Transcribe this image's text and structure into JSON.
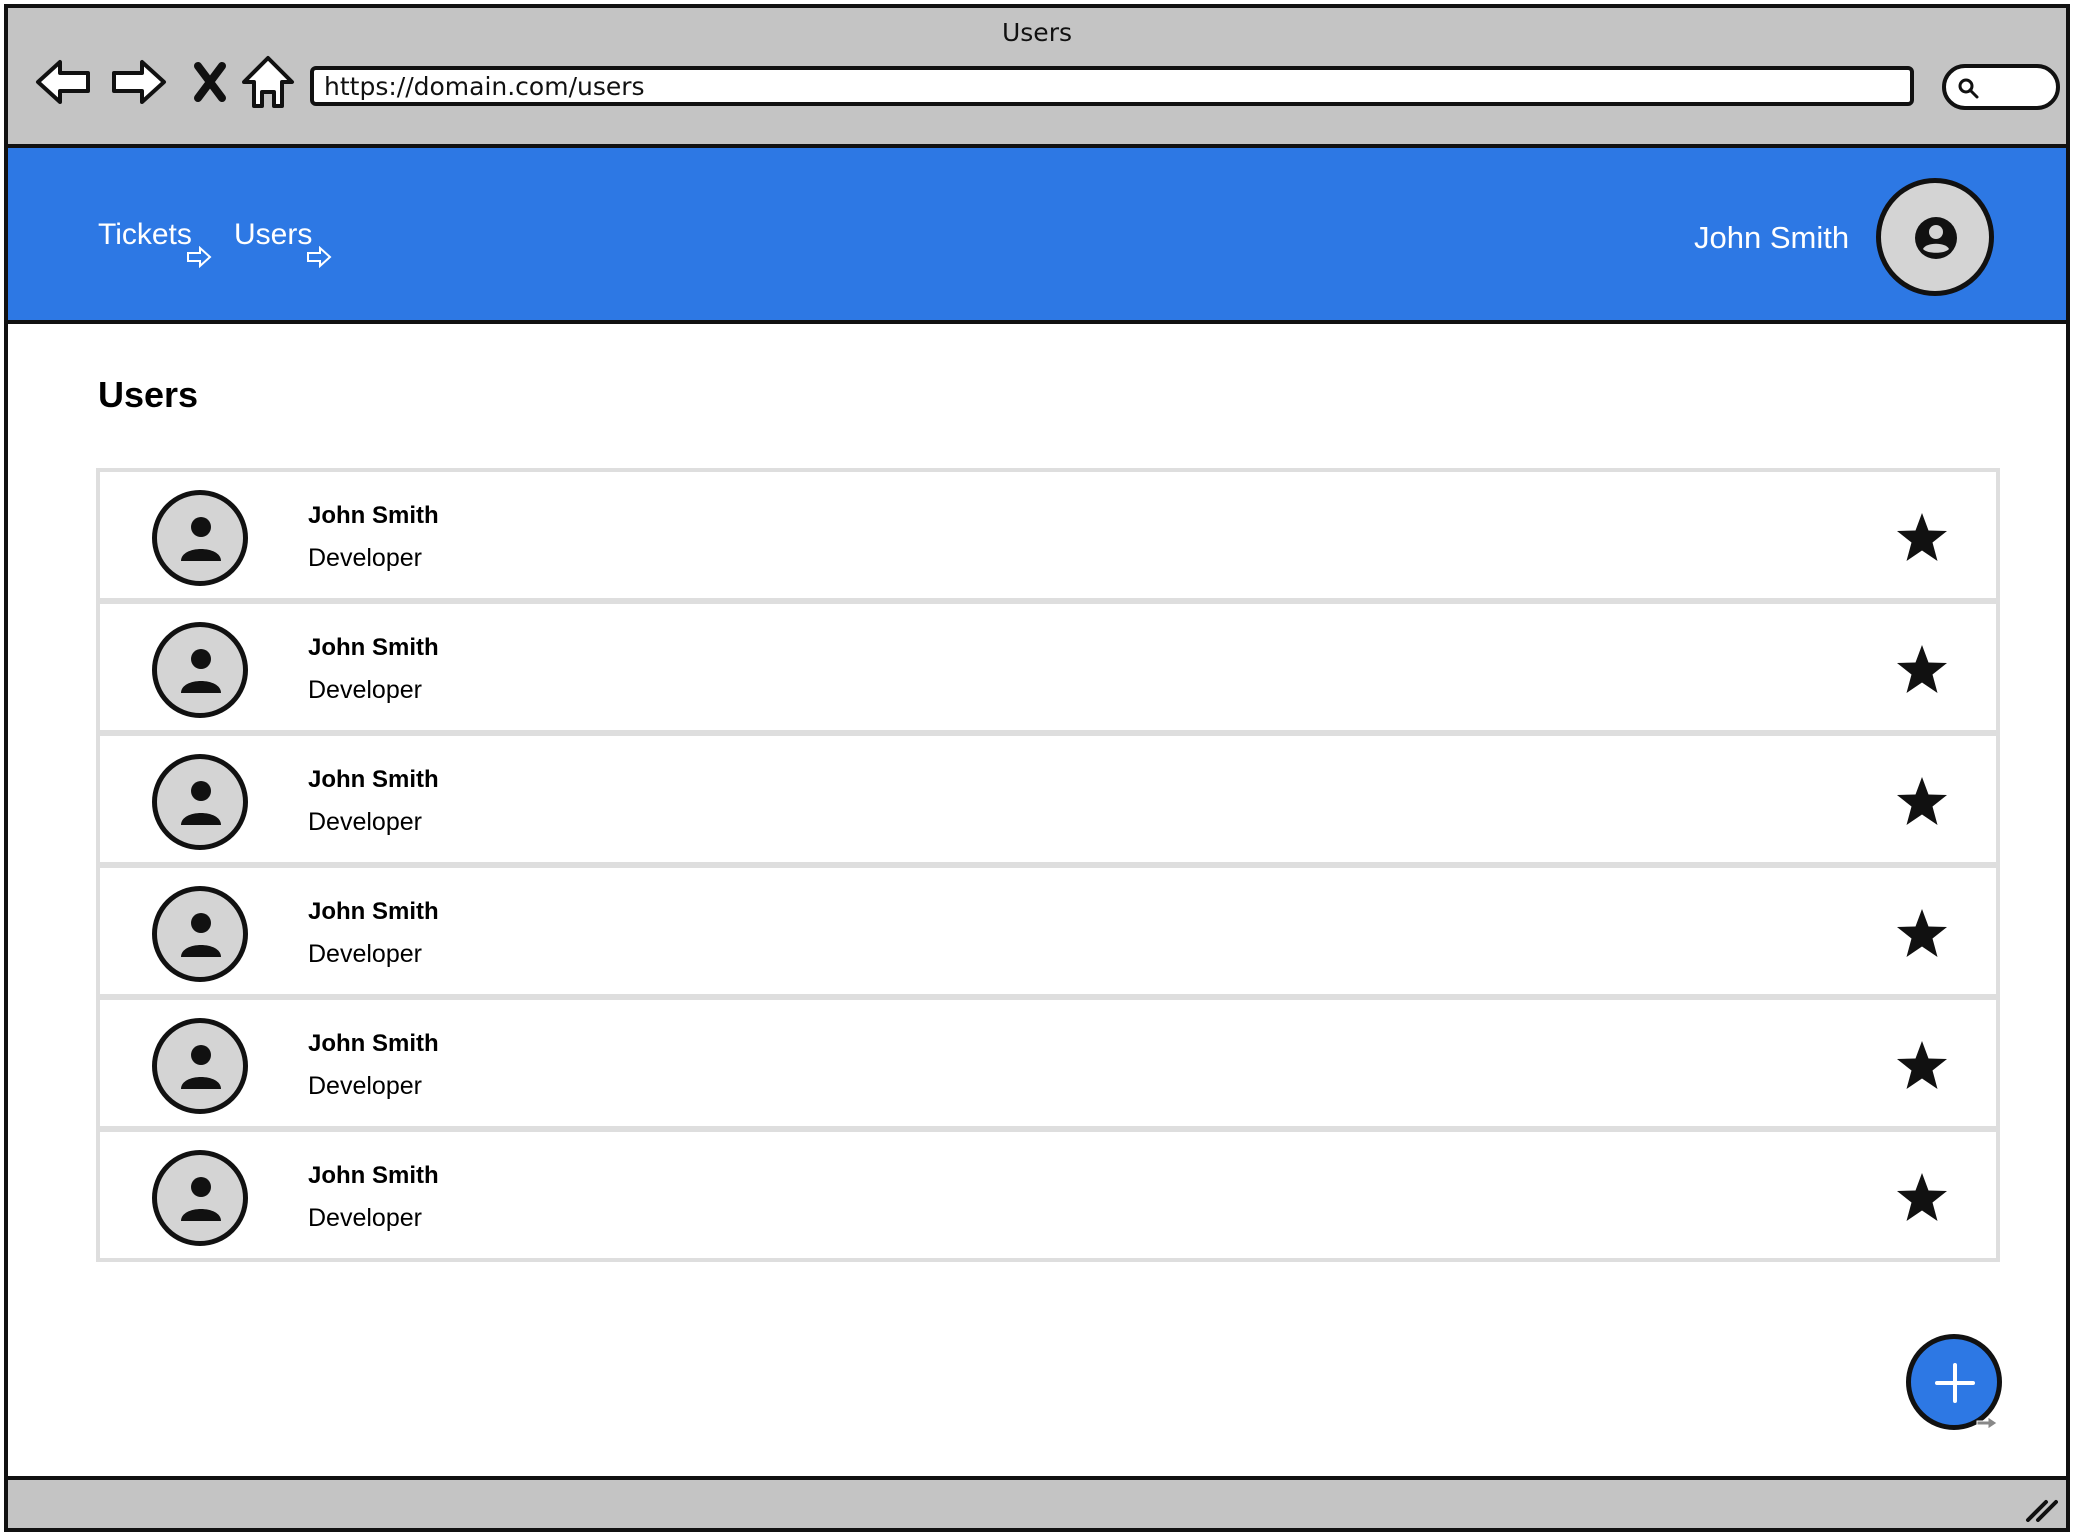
{
  "window": {
    "title": "Users"
  },
  "browser": {
    "url": "https://domain.com/users",
    "back_icon": "back-arrow-icon",
    "forward_icon": "forward-arrow-icon",
    "stop_icon": "close-icon",
    "home_icon": "home-icon",
    "search_icon": "search-icon"
  },
  "appbar": {
    "nav": [
      {
        "label": "Tickets"
      },
      {
        "label": "Users"
      }
    ],
    "user_name": "John Smith",
    "avatar_icon": "account-circle-icon"
  },
  "main": {
    "title": "Users",
    "users": [
      {
        "name": "John Smith",
        "role": "Developer",
        "icon": "star-icon"
      },
      {
        "name": "John Smith",
        "role": "Developer",
        "icon": "star-icon"
      },
      {
        "name": "John Smith",
        "role": "Developer",
        "icon": "star-icon"
      },
      {
        "name": "John Smith",
        "role": "Developer",
        "icon": "star-icon"
      },
      {
        "name": "John Smith",
        "role": "Developer",
        "icon": "star-icon"
      },
      {
        "name": "John Smith",
        "role": "Developer",
        "icon": "star-icon"
      }
    ],
    "fab_icon": "plus-icon"
  },
  "colors": {
    "accent": "#2d78e4",
    "chrome": "#c4c4c4",
    "avatar_bg": "#d4d4d4",
    "row_border": "#dedede"
  }
}
